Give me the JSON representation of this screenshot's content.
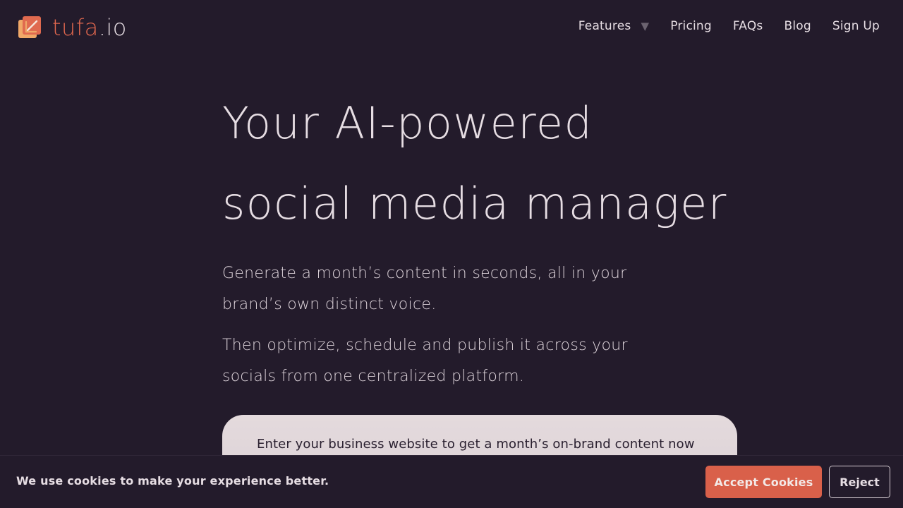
{
  "header": {
    "logo": {
      "name": "tufa",
      "tld": ".io"
    },
    "nav": {
      "features": "Features",
      "features_caret": "▼",
      "pricing": "Pricing",
      "faqs": "FAQs",
      "blog": "Blog",
      "signup": "Sign Up"
    }
  },
  "hero": {
    "title_line1": "Your AI-powered",
    "title_line2": "social media manager",
    "paragraph1": "Generate a month’s content in seconds, all in your brand’s own distinct voice.",
    "paragraph2": "Then optimize, schedule and publish it across your socials from one centralized platform.",
    "cta_prompt": "Enter your business website to get a month’s on-brand content now"
  },
  "cookie_banner": {
    "message": "We use cookies to make your experience better.",
    "accept_label": "Accept Cookies",
    "reject_label": "Reject"
  },
  "colors": {
    "background": "#231b2b",
    "accent": "#d9604a",
    "text": "#e6dde3",
    "card": "#e0d6da"
  }
}
